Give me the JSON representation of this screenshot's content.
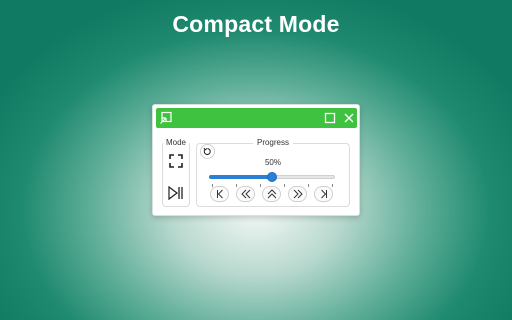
{
  "page": {
    "title": "Compact Mode"
  },
  "window": {
    "titlebar_color": "#3fc23f",
    "icons": {
      "collapse": "collapse-arrow-icon",
      "maximize": "maximize-icon",
      "close": "close-icon"
    }
  },
  "mode": {
    "label": "Mode",
    "buttons": [
      {
        "name": "fullscreen",
        "icon": "fullscreen-icon"
      },
      {
        "name": "play-pause",
        "icon": "play-pause-icon"
      }
    ]
  },
  "progress": {
    "label": "Progress",
    "value_text": "50%",
    "value": 0.5,
    "tick_count": 6,
    "reset_icon": "reset-icon",
    "accent": "#2b7fd4",
    "controls": [
      {
        "name": "first",
        "icon": "skip-to-start-icon"
      },
      {
        "name": "rewind",
        "icon": "double-chevron-left-icon"
      },
      {
        "name": "up",
        "icon": "double-chevron-up-icon"
      },
      {
        "name": "forward",
        "icon": "double-chevron-right-icon"
      },
      {
        "name": "last",
        "icon": "skip-to-end-icon"
      }
    ]
  }
}
